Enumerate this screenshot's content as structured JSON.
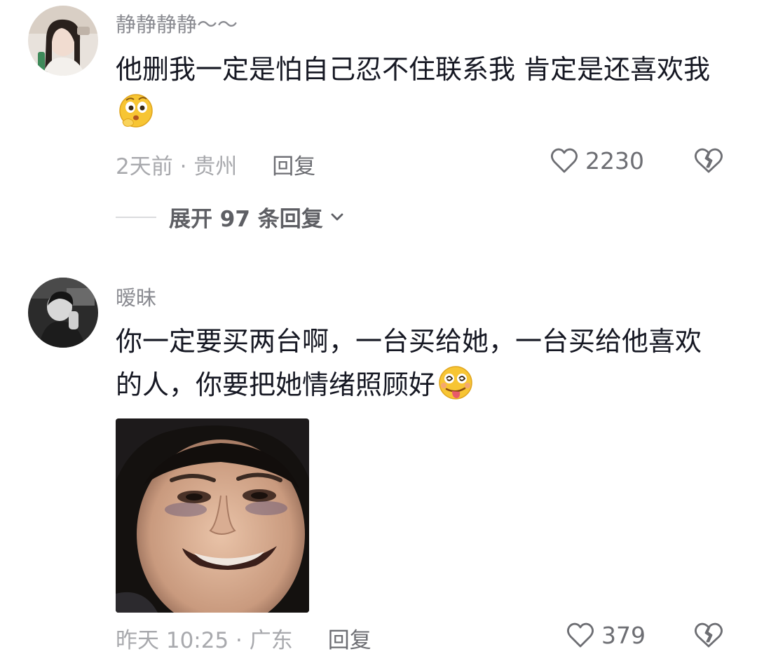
{
  "comments": [
    {
      "username": "静静静静～～",
      "text": "他删我一定是怕自己忍不住联系我  肯定是还喜欢我",
      "text_emoji": "sly-thinking-emoji",
      "meta": "2天前 · 贵州",
      "reply_label": "回复",
      "likes": "2230",
      "expand_replies": "展开 97 条回复"
    },
    {
      "username": "暧昧",
      "text": "你一定要买两台啊，一台买给她，一台买给他喜欢的人，你要把她情绪照顾好",
      "text_emoji": "dizzy-tongue-emoji",
      "meta": "昨天 10:25 · 广东",
      "reply_label": "回复",
      "likes": "379",
      "has_image": true
    }
  ],
  "icons": {
    "like": "heart-outline-icon",
    "dislike": "broken-heart-icon",
    "expand": "chevron-down-icon"
  },
  "colors": {
    "text_primary": "#161823",
    "username": "#8a8b91",
    "meta": "#a8a9ad",
    "action": "#6d6e73"
  }
}
